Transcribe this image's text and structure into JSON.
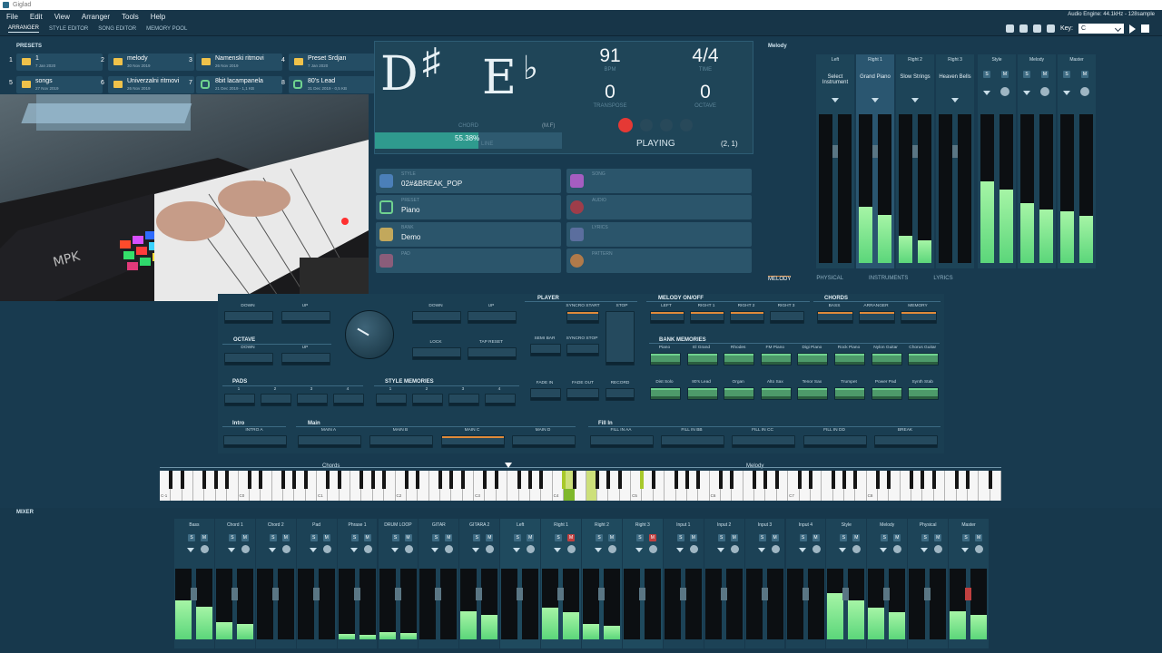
{
  "window": {
    "title": "Giglad",
    "audio_engine": "Audio Engine: 44.1kHz - 128sample"
  },
  "menu": [
    "File",
    "Edit",
    "View",
    "Arranger",
    "Tools",
    "Help"
  ],
  "tabs": [
    "ARRANGER",
    "STYLE EDITOR",
    "SONG EDITOR",
    "MEMORY POOL"
  ],
  "key": {
    "label": "Key:",
    "value": "C"
  },
  "presets": {
    "title": "PRESETS",
    "items": [
      {
        "num": "1",
        "name": "1",
        "date": "7 Jan 2020",
        "type": "folder"
      },
      {
        "num": "2",
        "name": "melody",
        "date": "30 Nov 2019",
        "type": "folder"
      },
      {
        "num": "3",
        "name": "Namenski ritmovi",
        "date": "26 Nov 2019",
        "type": "folder"
      },
      {
        "num": "4",
        "name": "Preset Srdjan",
        "date": "7 Jan 2020",
        "type": "folder"
      },
      {
        "num": "5",
        "name": "songs",
        "date": "27 Nov 2019",
        "type": "folder"
      },
      {
        "num": "6",
        "name": "Univerzalni ritmovi",
        "date": "26 Nov 2019",
        "type": "folder"
      },
      {
        "num": "7",
        "name": "8bit lacampanela",
        "date": "21 Dec 2019 - 1,1 KB",
        "type": "link"
      },
      {
        "num": "8",
        "name": "80's Lead",
        "date": "31 Dec 2019 - 0,5 KB",
        "type": "link"
      }
    ]
  },
  "chord": {
    "root": "D",
    "root_acc": "♯",
    "bass": "E",
    "bass_acc": "♭",
    "chord_label": "CHORD",
    "mf": "(M.F)",
    "progress_text": "55.38%",
    "progress": 0.5538,
    "line_label": "LINE"
  },
  "tempo": {
    "value": "91",
    "label": "BPM"
  },
  "time": {
    "value": "4/4",
    "label": "TIME"
  },
  "transpose": {
    "value": "0",
    "label": "TRANSPOSE"
  },
  "octave": {
    "value": "0",
    "label": "OCTAVE"
  },
  "playing": {
    "status": "PLAYING",
    "pos": "(2, 1)"
  },
  "info": {
    "style": {
      "label": "STYLE",
      "value": "02#&BREAK_POP"
    },
    "preset": {
      "label": "PRESET",
      "value": "Piano"
    },
    "bank": {
      "label": "BANK",
      "value": "Demo"
    },
    "pad": {
      "label": "PAD",
      "value": ""
    },
    "song": {
      "label": "SONG",
      "value": ""
    },
    "audio": {
      "label": "AUDIO",
      "value": ""
    },
    "lyrics": {
      "label": "LYRICS",
      "value": ""
    },
    "pattern": {
      "label": "PATTERN",
      "value": ""
    }
  },
  "melody": {
    "title": "Melody",
    "channels": [
      {
        "name": "Left",
        "instrument": "Select Instrument"
      },
      {
        "name": "Right 1",
        "instrument": "Grand Piano"
      },
      {
        "name": "Right 2",
        "instrument": "Slow Strings"
      },
      {
        "name": "Right 3",
        "instrument": "Heaven Bells"
      }
    ],
    "groups": [
      "Style",
      "Melody",
      "Master"
    ],
    "subtabs": [
      "MELODY",
      "PHYSICAL",
      "INSTRUMENTS",
      "LYRICS"
    ]
  },
  "controls": {
    "down": "DOWN",
    "up": "UP",
    "octave": "OCTAVE",
    "lock": "LOCK",
    "tap_reset": "TAP RESET",
    "pads": "PADS",
    "style_memories": "STYLE MEMORIES",
    "nums": [
      "1",
      "2",
      "3",
      "4"
    ],
    "player": "PLAYER",
    "syncro_start": "SYNCRO START",
    "stop": "STOP",
    "semi_bar": "SEMI BAR",
    "syncro_stop": "SYNCRO STOP",
    "fade_in": "FADE IN",
    "fade_out": "FADE OUT",
    "record": "RECORD",
    "melody_onoff": "MELODY ON/OFF",
    "melody_parts": [
      "LEFT",
      "RIGHT 1",
      "RIGHT 2",
      "RIGHT 3"
    ],
    "chords": "CHORDS",
    "chord_parts": [
      "BASS",
      "ARRANGER",
      "MEMORY"
    ],
    "bank_memories": "BANK MEMORIES",
    "banks1": [
      "Piano",
      "El Grand",
      "Rhodes",
      "FM Piano",
      "Digi Piano",
      "Rock Piano",
      "Nylon Guitar",
      "Chorus Guitar"
    ],
    "banks2": [
      "Dist Solo",
      "80's Lead",
      "Organ",
      "Alto Sax",
      "Tenor Sax",
      "Trumpet",
      "Power Pad",
      "Synth Stab"
    ],
    "intro": "Intro",
    "main": "Main",
    "fillin": "Fill In",
    "sections": [
      "INTRO A",
      "MAIN A",
      "MAIN B",
      "MAIN C",
      "MAIN D",
      "FILL IN AA",
      "FILL IN BB",
      "FILL IN CC",
      "FILL IN DD",
      "BREAK"
    ]
  },
  "keyboard": {
    "chords_label": "Chords",
    "melody_label": "Melody",
    "octaves": [
      "C-1",
      "C0",
      "C1",
      "C2",
      "C3",
      "C4",
      "C5",
      "C6",
      "C7",
      "C8"
    ]
  },
  "mixer": {
    "title": "MIXER",
    "channels": [
      {
        "name": "Bass",
        "level": 0.55
      },
      {
        "name": "Chord 1",
        "level": 0.25
      },
      {
        "name": "Chord 2",
        "level": 0
      },
      {
        "name": "Pad",
        "level": 0
      },
      {
        "name": "Phrase 1",
        "level": 0.08
      },
      {
        "name": "DRUM LOOP",
        "level": 0.1
      },
      {
        "name": "GITAR",
        "level": 0
      },
      {
        "name": "GITARA 2",
        "level": 0.4
      },
      {
        "name": "Left",
        "level": 0
      },
      {
        "name": "Right 1",
        "level": 0.45
      },
      {
        "name": "Right 2",
        "level": 0.22
      },
      {
        "name": "Right 3",
        "level": 0
      },
      {
        "name": "Input 1",
        "level": 0
      },
      {
        "name": "Input 2",
        "level": 0
      },
      {
        "name": "Input 3",
        "level": 0
      },
      {
        "name": "Input 4",
        "level": 0
      },
      {
        "name": "Style",
        "level": 0.65
      },
      {
        "name": "Melody",
        "level": 0.45
      },
      {
        "name": "Physical",
        "level": 0
      },
      {
        "name": "Master",
        "level": 0.4
      }
    ]
  },
  "colors": {
    "bg": "#183a4f",
    "panel": "#1f4558",
    "accent_green": "#6fd28f",
    "accent_orange": "#e08a3a",
    "record": "#e53935"
  }
}
